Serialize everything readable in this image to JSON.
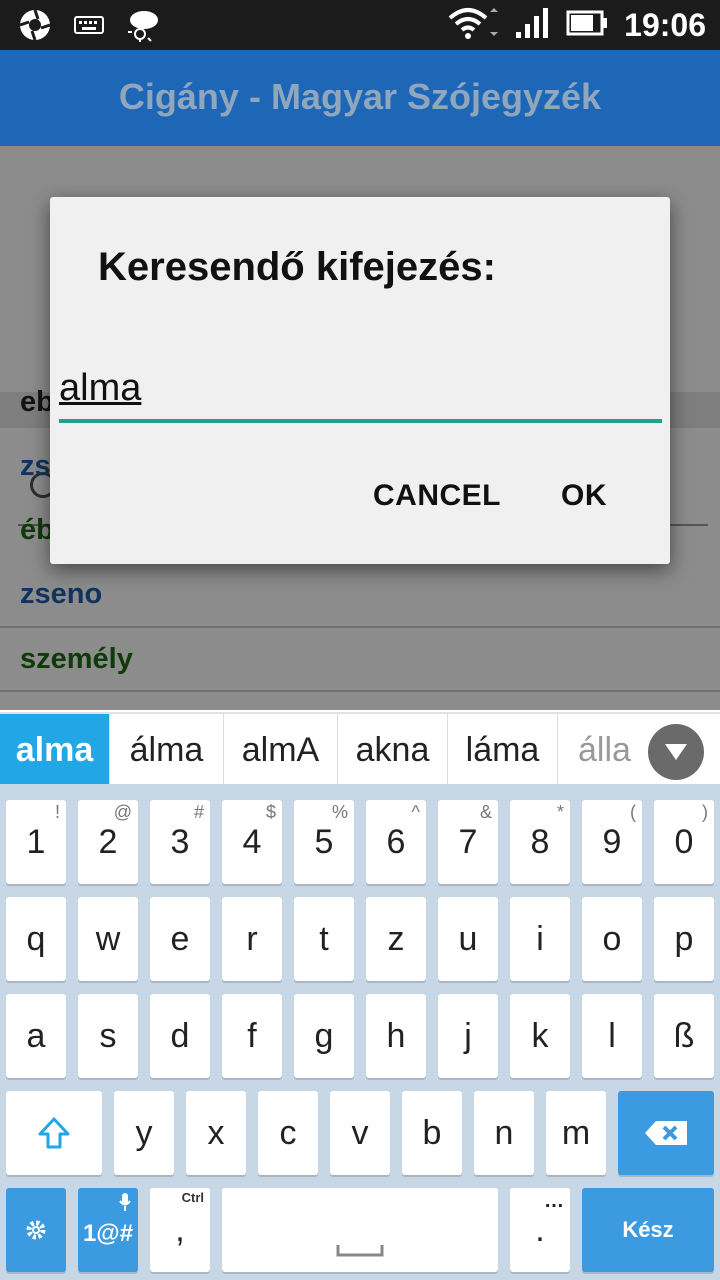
{
  "status_bar": {
    "time": "19:06",
    "icons": [
      "aperture-icon",
      "keyboard-icon",
      "weather-icon",
      "wifi-icon",
      "signal-icon",
      "battery-icon"
    ]
  },
  "app": {
    "title": "Cigány - Magyar Szójegyzék"
  },
  "background_list": {
    "items": [
      {
        "text": "zseno",
        "color": "#1e5fae"
      },
      {
        "text": "személy",
        "color": "#1d6a12"
      }
    ],
    "partial_items": [
      {
        "text": "eb",
        "color": "#222222"
      },
      {
        "text": "zs",
        "color": "#1e5fae"
      },
      {
        "text": "éb",
        "color": "#1d6a12"
      }
    ]
  },
  "dialog": {
    "title": "Keresendő kifejezés:",
    "input_value": "alma",
    "cancel_label": "CANCEL",
    "ok_label": "OK"
  },
  "suggestions": {
    "items": [
      "alma",
      "álma",
      "almA",
      "akna",
      "láma",
      "álla"
    ],
    "active_index": 0
  },
  "keyboard": {
    "number_row": [
      {
        "key": "1",
        "alt": "!"
      },
      {
        "key": "2",
        "alt": "@"
      },
      {
        "key": "3",
        "alt": "#"
      },
      {
        "key": "4",
        "alt": "$"
      },
      {
        "key": "5",
        "alt": "%"
      },
      {
        "key": "6",
        "alt": "^"
      },
      {
        "key": "7",
        "alt": "&"
      },
      {
        "key": "8",
        "alt": "*"
      },
      {
        "key": "9",
        "alt": "("
      },
      {
        "key": "0",
        "alt": ")"
      }
    ],
    "row1": [
      "q",
      "w",
      "e",
      "r",
      "t",
      "z",
      "u",
      "i",
      "o",
      "p"
    ],
    "row2": [
      "a",
      "s",
      "d",
      "f",
      "g",
      "h",
      "j",
      "k",
      "l",
      "ß"
    ],
    "row3": [
      "y",
      "x",
      "c",
      "v",
      "b",
      "n",
      "m"
    ],
    "symbols_label": "1@#",
    "comma": ",",
    "comma_alt": "Ctrl",
    "period": ".",
    "period_alt": "…",
    "done_label": "Kész"
  },
  "colors": {
    "app_bar": "#1e67b7",
    "accent": "#1ea28a",
    "suggestion_active": "#21a7e6",
    "key_blue": "#3c9ae0"
  }
}
